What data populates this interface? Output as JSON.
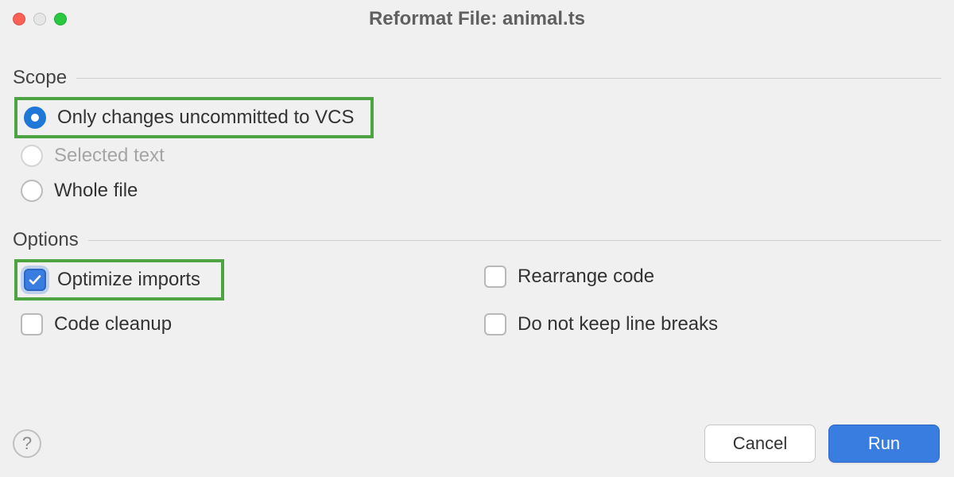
{
  "window": {
    "title": "Reformat File: animal.ts"
  },
  "sections": {
    "scope": {
      "label": "Scope",
      "options": {
        "uncommitted": {
          "label": "Only changes uncommitted to VCS",
          "selected": true,
          "enabled": true,
          "highlighted": true
        },
        "selected_text": {
          "label": "Selected text",
          "selected": false,
          "enabled": false
        },
        "whole_file": {
          "label": "Whole file",
          "selected": false,
          "enabled": true
        }
      }
    },
    "options": {
      "label": "Options",
      "items": {
        "optimize_imports": {
          "label": "Optimize imports",
          "checked": true,
          "highlighted": true
        },
        "rearrange_code": {
          "label": "Rearrange code",
          "checked": false
        },
        "code_cleanup": {
          "label": "Code cleanup",
          "checked": false
        },
        "no_line_breaks": {
          "label": "Do not keep line breaks",
          "checked": false
        }
      }
    }
  },
  "buttons": {
    "help": "?",
    "cancel": "Cancel",
    "run": "Run"
  }
}
